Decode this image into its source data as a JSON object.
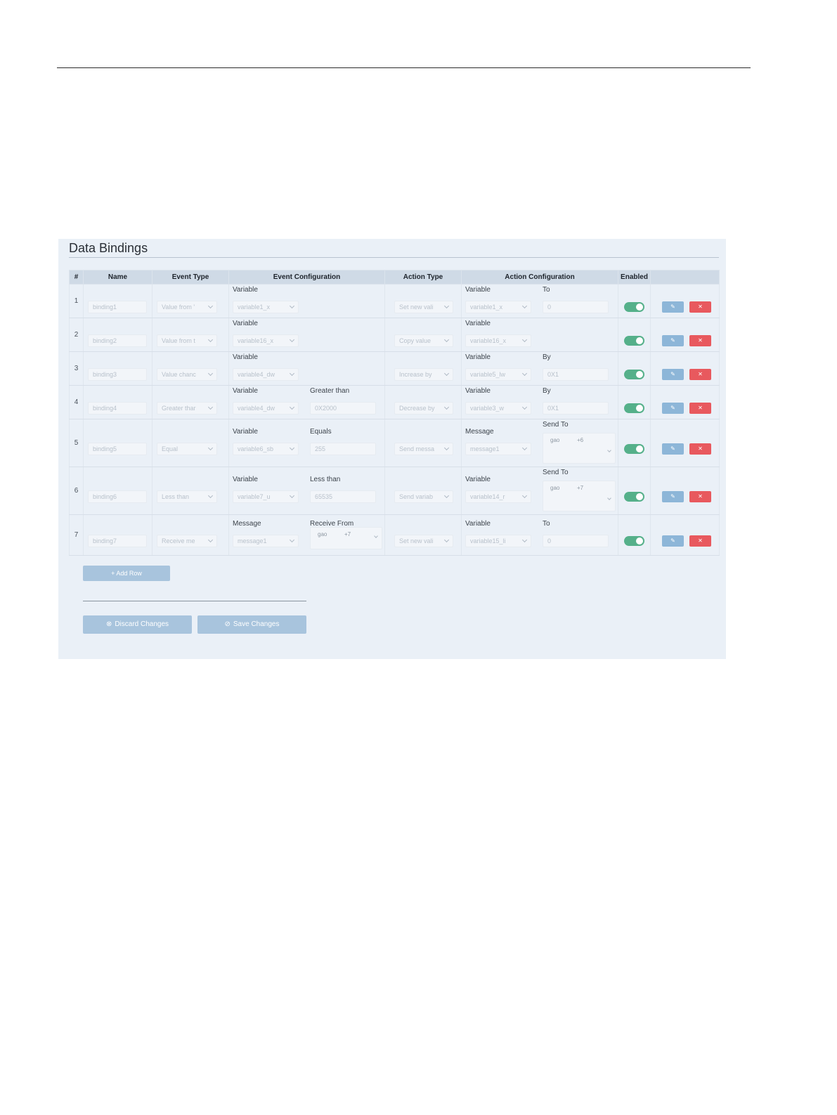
{
  "panel": {
    "title": "Data Bindings",
    "add_row_icon": "+",
    "add_row_label": "Add Row",
    "discard_icon": "⊗",
    "discard_label": "Discard Changes",
    "save_icon": "⊘",
    "save_label": "Save Changes"
  },
  "table": {
    "headers": {
      "num": "#",
      "name": "Name",
      "event_type": "Event Type",
      "event_config": "Event Configuration",
      "action_type": "Action Type",
      "action_config": "Action Configuration",
      "enabled": "Enabled"
    },
    "icons": {
      "edit": "edit-icon",
      "delete": "trash-icon"
    },
    "rows": [
      {
        "num": "1",
        "name": "binding1",
        "event_type": "Value from '",
        "ev1_label": "Variable",
        "ev1_value": "variable1_x",
        "action_type": "Set new vali",
        "ac1_label": "Variable",
        "ac1_value": "variable1_x",
        "ac2_label": "To",
        "ac2_value": "0",
        "enabled": true
      },
      {
        "num": "2",
        "name": "binding2",
        "event_type": "Value from t",
        "ev1_label": "Variable",
        "ev1_value": "variable16_x",
        "action_type": "Copy value",
        "ac1_label": "Variable",
        "ac1_value": "variable16_x",
        "enabled": true
      },
      {
        "num": "3",
        "name": "binding3",
        "event_type": "Value chanc",
        "ev1_label": "Variable",
        "ev1_value": "variable4_dw",
        "action_type": "Increase by",
        "ac1_label": "Variable",
        "ac1_value": "variable5_lw",
        "ac2_label": "By",
        "ac2_value": "0X1",
        "enabled": true
      },
      {
        "num": "4",
        "name": "binding4",
        "event_type": "Greater thar",
        "ev1_label": "Variable",
        "ev1_value": "variable4_dw",
        "ev2_label": "Greater than",
        "ev2_value": "0X2000",
        "action_type": "Decrease by",
        "ac1_label": "Variable",
        "ac1_value": "variable3_w",
        "ac2_label": "By",
        "ac2_value": "0X1",
        "enabled": true
      },
      {
        "num": "5",
        "name": "binding5",
        "event_type": "Equal",
        "ev1_label": "Variable",
        "ev1_value": "variable6_sb",
        "ev2_label": "Equals",
        "ev2_value": "255",
        "action_type": "Send messa",
        "ac1_label": "Message",
        "ac1_value": "message1",
        "ac2_label": "Send To",
        "ac2_tags": [
          "gao",
          "+6"
        ],
        "enabled": true
      },
      {
        "num": "6",
        "name": "binding6",
        "event_type": "Less than",
        "ev1_label": "Variable",
        "ev1_value": "variable7_u",
        "ev2_label": "Less than",
        "ev2_value": "65535",
        "action_type": "Send variab",
        "ac1_label": "Variable",
        "ac1_value": "variable14_r",
        "ac2_label": "Send To",
        "ac2_tags": [
          "gao",
          "+7"
        ],
        "enabled": true
      },
      {
        "num": "7",
        "name": "binding7",
        "event_type": "Receive me",
        "ev1_label": "Message",
        "ev1_value": "message1",
        "ev2_label": "Receive From",
        "ev2_tags": [
          "gao",
          "+7"
        ],
        "action_type": "Set new vali",
        "ac1_label": "Variable",
        "ac1_value": "variable15_li",
        "ac2_label": "To",
        "ac2_value": "0",
        "enabled": true
      }
    ]
  }
}
